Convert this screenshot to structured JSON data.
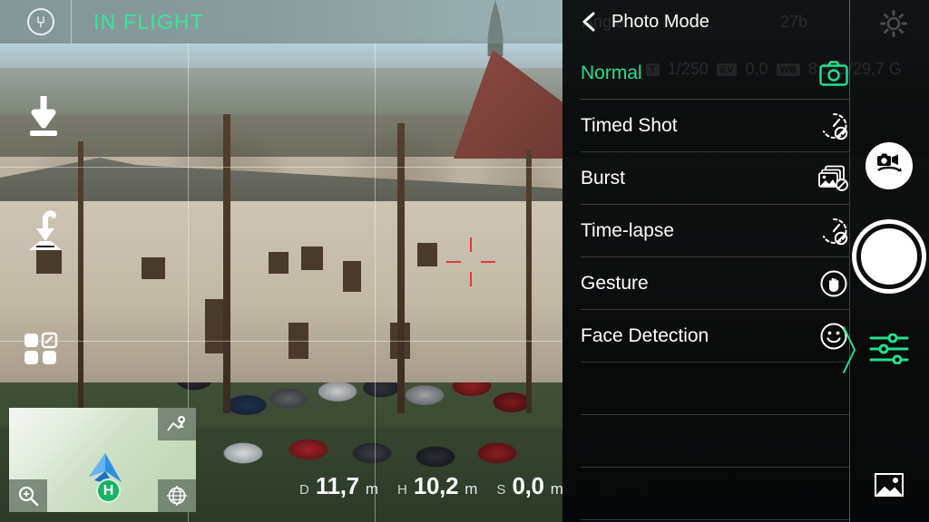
{
  "app": {
    "flight_status": "IN FLIGHT",
    "logo_icon": "yuneec-logo-icon",
    "accent_green": "#33e89b",
    "selected_green": "#22e08d",
    "reticle_color": "#e03a3a"
  },
  "left_controls": [
    {
      "name": "land-button",
      "icon": "land-arrow-icon"
    },
    {
      "name": "return-to-home-button",
      "icon": "return-to-home-icon"
    },
    {
      "name": "view-layout-button",
      "icon": "grid-layout-icon"
    }
  ],
  "minimap": {
    "home_marker_label": "H",
    "aircraft_icon": "aircraft-arrow-icon",
    "corner_buttons": [
      {
        "name": "map-pin-button",
        "icon": "map-pin-icon"
      },
      {
        "name": "map-zoom-button",
        "icon": "magnifier-plus-icon"
      },
      {
        "name": "map-globe-button",
        "icon": "globe-icon"
      }
    ]
  },
  "telemetry": {
    "distance": {
      "key": "D",
      "value": "11,7",
      "unit": "m"
    },
    "height": {
      "key": "H",
      "value": "10,2",
      "unit": "m"
    },
    "speed": {
      "key": "S",
      "value": "0,0",
      "unit": "m/s"
    },
    "time": {
      "key": "T",
      "value": "12:43"
    }
  },
  "panel": {
    "back_label": "Angle",
    "back_icon": "chevron-left-icon",
    "title": "Photo Mode",
    "gear_icon": "gear-icon",
    "collapse_icon": "chevron-right-icon",
    "items": [
      {
        "label": "Normal",
        "icon": "camera-icon",
        "selected": true
      },
      {
        "label": "Timed Shot",
        "icon": "timer-disabled-icon",
        "selected": false
      },
      {
        "label": "Burst",
        "icon": "burst-disabled-icon",
        "selected": false
      },
      {
        "label": "Time-lapse",
        "icon": "timelapse-disabled-icon",
        "selected": false
      },
      {
        "label": "Gesture",
        "icon": "hand-gesture-icon",
        "selected": false
      },
      {
        "label": "Face Detection",
        "icon": "smiley-face-icon",
        "selected": false
      }
    ]
  },
  "ghost_overlay": {
    "back_label": "Angle",
    "shutter_badge": "T",
    "shutter_value": "1/250",
    "ev_badge": "EV",
    "ev_value": "0,0",
    "wb_badge": "WB",
    "storage": "8,5 G/29,7 G",
    "signal_value": "27b"
  },
  "right_rail": {
    "mode_toggle_icon": "camera-video-switch-icon",
    "shutter_button": "shutter-button",
    "sliders_icon": "settings-sliders-icon",
    "gallery_icon": "gallery-image-icon"
  }
}
